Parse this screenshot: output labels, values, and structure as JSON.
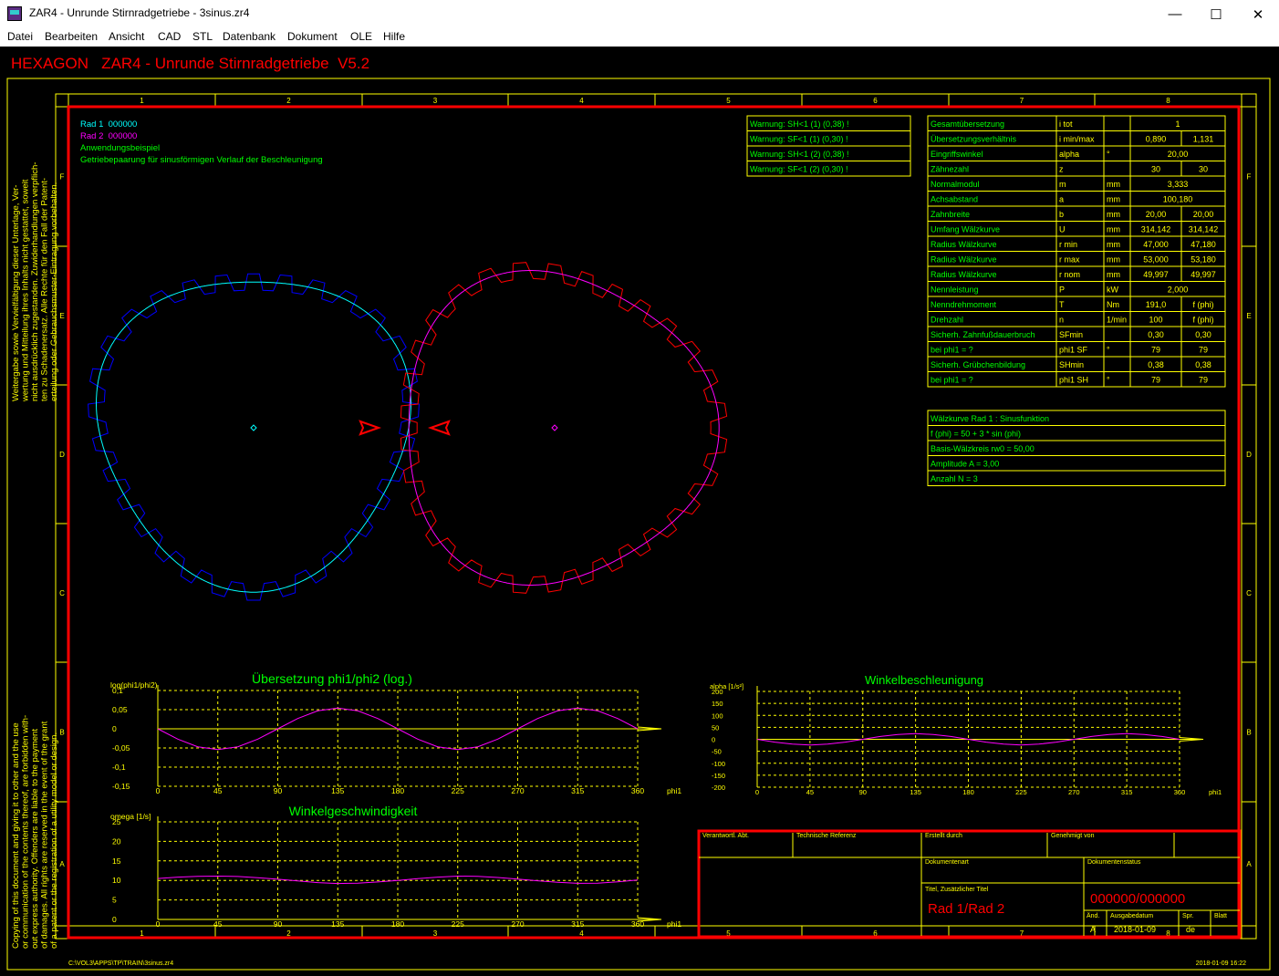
{
  "window": {
    "title": "ZAR4 - Unrunde Stirnradgetriebe  -  3sinus.zr4",
    "min": "—",
    "max": "☐",
    "close": "✕"
  },
  "menu": [
    "Datei",
    "Bearbeiten",
    "Ansicht",
    "CAD",
    "STL",
    "Datenbank",
    "Dokument",
    "OLE",
    "Hilfe"
  ],
  "header": "HEXAGON   ZAR4 - Unrunde Stirnradgetriebe  V5.2",
  "frame": {
    "cols": [
      "1",
      "2",
      "3",
      "4",
      "5",
      "6",
      "7",
      "8"
    ],
    "rows": [
      "F",
      "E",
      "D",
      "C",
      "B",
      "A"
    ]
  },
  "info": {
    "rad1": "Rad 1  000000",
    "rad2": "Rad 2  000000",
    "line3": "Anwendungsbeispiel",
    "line4": "Getriebepaarung für sinusförmigen Verlauf der Beschleunigung"
  },
  "left_note_top": [
    "Weitergabe sowie Vervielfältigung dieser Unterlage, Ver-",
    "wertung und Mitteilung ihres Inhalts nicht gestattet, soweit",
    "nicht ausdrücklich zugestanden. Zuwiderhandlungen verpflich-",
    "ten zu Schadenersatz. Alle Rechte für den Fall der Patent-",
    "erteilung oder Gebrauchsmuster-Eintragung vorbehalten."
  ],
  "left_note_bottom": [
    "Copying of this document and giving it to other and the use",
    "or communication of the contents thereof, are forbidden with-",
    "out express authority. Offenders are liable to the payment",
    "of damages. All rights are reserved in the event of the grant",
    "of a patent or the registration of a utility model or design."
  ],
  "warnings": [
    "Warnung: SH<1 (1) (0,38) !",
    "Warnung: SF<1 (1) (0,30) !",
    "Warnung: SH<1 (2) (0,38) !",
    "Warnung: SF<1 (2) (0,30) !"
  ],
  "params": [
    [
      "Gesamtübersetzung",
      "i tot",
      "",
      "1",
      ""
    ],
    [
      "Übersetzungsverhältnis",
      "i min/max",
      "",
      "0,890",
      "1,131"
    ],
    [
      "Eingriffswinkel",
      "alpha",
      "°",
      "20,00",
      ""
    ],
    [
      "Zähnezahl",
      "z",
      "",
      "30",
      "30"
    ],
    [
      "Normalmodul",
      "m",
      "mm",
      "3,333",
      ""
    ],
    [
      "Achsabstand",
      "a",
      "mm",
      "100,180",
      ""
    ],
    [
      "Zahnbreite",
      "b",
      "mm",
      "20,00",
      "20,00"
    ],
    [
      "Umfang Wälzkurve",
      "U",
      "mm",
      "314,142",
      "314,142"
    ],
    [
      "Radius Wälzkurve",
      "r min",
      "mm",
      "47,000",
      "47,180"
    ],
    [
      "Radius Wälzkurve",
      "r max",
      "mm",
      "53,000",
      "53,180"
    ],
    [
      "Radius Wälzkurve",
      "r nom",
      "mm",
      "49,997",
      "49,997"
    ],
    [
      "Nennleistung",
      "P",
      "kW",
      "2,000",
      ""
    ],
    [
      "Nenndrehmoment",
      "T",
      "Nm",
      "191,0",
      "f (phi)"
    ],
    [
      "Drehzahl",
      "n",
      "1/min",
      "100",
      "f (phi)"
    ],
    [
      "Sicherh. Zahnfußdauerbruch",
      "SFmin",
      "",
      "0,30",
      "0,30"
    ],
    [
      "bei phi1 = ?",
      "phi1 SF",
      "°",
      "79",
      "79"
    ],
    [
      "Sicherh. Grübchenbildung",
      "SHmin",
      "",
      "0,38",
      "0,38"
    ],
    [
      "bei phi1 = ?",
      "phi1 SH",
      "°",
      "79",
      "79"
    ]
  ],
  "pitch": [
    "Wälzkurve Rad 1 : Sinusfunktion",
    "f (phi) = 50 + 3 * sin (phi)",
    "Basis-Wälzkreis rw0 =     50,00",
    "Amplitude A =      3,00",
    "Anzahl N = 3"
  ],
  "gears": {
    "teeth": 30,
    "base_radius_mm": 50,
    "amplitude_mm": 3,
    "lobes": 3
  },
  "charts": [
    {
      "title": "Übersetzung phi1/phi2 (log.)",
      "ylabel": "log(phi1/phi2)",
      "xlabel": "phi1",
      "yticks": [
        "0,1",
        "0,05",
        "0",
        "-0,05",
        "-0,1",
        "-0,15"
      ],
      "xticks": [
        "0",
        "45",
        "90",
        "135",
        "180",
        "225",
        "270",
        "315",
        "360"
      ]
    },
    {
      "title": "Winkelbeschleunigung",
      "ylabel": "alpha [1/s²]",
      "xlabel": "phi1",
      "yticks": [
        "200",
        "150",
        "100",
        "50",
        "0",
        "-50",
        "-100",
        "-150",
        "-200"
      ],
      "xticks": [
        "0",
        "45",
        "90",
        "135",
        "180",
        "225",
        "270",
        "315",
        "360"
      ]
    },
    {
      "title": "Winkelgeschwindigkeit",
      "ylabel": "omega [1/s]",
      "xlabel": "phi1",
      "yticks": [
        "25",
        "20",
        "15",
        "10",
        "5",
        "0"
      ],
      "xticks": [
        "0",
        "45",
        "90",
        "135",
        "180",
        "225",
        "270",
        "315",
        "360"
      ]
    }
  ],
  "chart_data": [
    {
      "type": "line",
      "title": "Übersetzung phi1/phi2 (log.)",
      "xlabel": "phi1",
      "ylabel": "log(phi1/phi2)",
      "xlim": [
        0,
        360
      ],
      "ylim": [
        -0.15,
        0.1
      ],
      "x": [
        0,
        15,
        30,
        45,
        60,
        75,
        90,
        105,
        120,
        135,
        150,
        165,
        180,
        195,
        210,
        225,
        240,
        255,
        270,
        285,
        300,
        315,
        330,
        345,
        360
      ],
      "y": [
        0,
        -0.027,
        -0.047,
        -0.054,
        -0.047,
        -0.027,
        0,
        0.027,
        0.047,
        0.054,
        0.047,
        0.027,
        0,
        -0.027,
        -0.047,
        -0.054,
        -0.047,
        -0.027,
        0,
        0.027,
        0.047,
        0.054,
        0.047,
        0.027,
        0
      ]
    },
    {
      "type": "line",
      "title": "Winkelbeschleunigung",
      "xlabel": "phi1",
      "ylabel": "alpha [1/s²]",
      "xlim": [
        0,
        360
      ],
      "ylim": [
        -200,
        200
      ],
      "x": [
        0,
        15,
        30,
        45,
        60,
        75,
        90,
        105,
        120,
        135,
        150,
        165,
        180,
        195,
        210,
        225,
        240,
        255,
        270,
        285,
        300,
        315,
        330,
        345,
        360
      ],
      "y": [
        0,
        -12,
        -20,
        -24,
        -20,
        -12,
        0,
        12,
        20,
        24,
        20,
        12,
        0,
        -12,
        -20,
        -24,
        -20,
        -12,
        0,
        12,
        20,
        24,
        20,
        12,
        0
      ]
    },
    {
      "type": "line",
      "title": "Winkelgeschwindigkeit",
      "xlabel": "phi1",
      "ylabel": "omega [1/s]",
      "xlim": [
        0,
        360
      ],
      "ylim": [
        0,
        25
      ],
      "x": [
        0,
        15,
        30,
        45,
        60,
        75,
        90,
        105,
        120,
        135,
        150,
        165,
        180,
        195,
        210,
        225,
        240,
        255,
        270,
        285,
        300,
        315,
        330,
        345,
        360
      ],
      "y": [
        10.5,
        10.85,
        11.05,
        11.1,
        11.0,
        10.7,
        10.3,
        9.85,
        9.45,
        9.2,
        9.3,
        9.6,
        10.0,
        10.45,
        10.85,
        11.1,
        11.05,
        10.75,
        10.35,
        9.9,
        9.5,
        9.25,
        9.3,
        9.65,
        10.1
      ]
    }
  ],
  "titleblock": {
    "h1": "Verantwortl. Abt.",
    "h2": "Technische Referenz",
    "h3": "Erstellt durch",
    "h4": "Genehmigt von",
    "doctype": "Dokumentenart",
    "docstatus": "Dokumentenstatus",
    "titlelabel": "Titel, Zusätzlicher Titel",
    "title": "Rad 1/Rad 2",
    "docnum": "000000/000000",
    "rev": "Änd.",
    "issue": "Ausgabedatum",
    "lang": "Spr.",
    "sheet": "Blatt",
    "rev_v": "A",
    "issue_v": "2018-01-09",
    "lang_v": "de"
  },
  "footer": {
    "path": "C:\\VOL3\\APPS\\TP\\TRAIN\\3sinus.zr4",
    "stamp": "2018-01-09 16:22"
  },
  "colors": {
    "yellow": "#ffff00",
    "red": "#ff0000",
    "green": "#00ff00",
    "cyan": "#00ffff",
    "magenta": "#ff00ff",
    "blue": "#0000ff"
  }
}
